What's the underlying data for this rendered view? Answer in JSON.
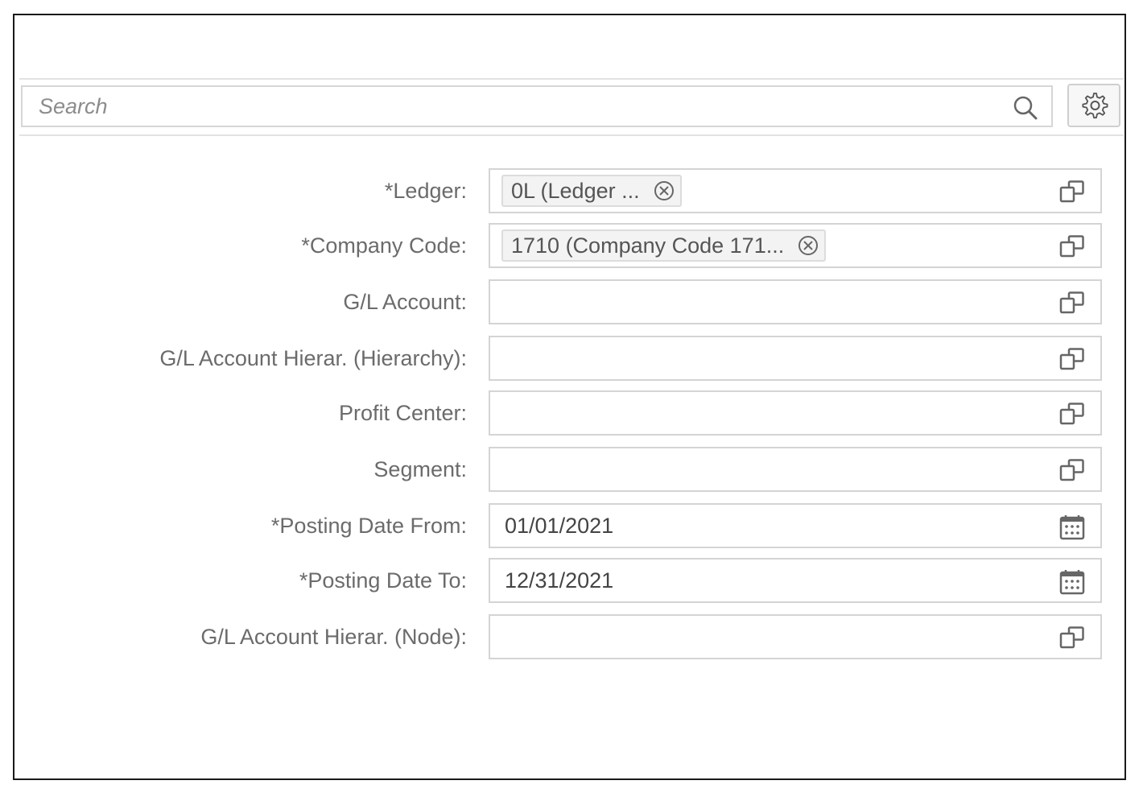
{
  "search": {
    "placeholder": "Search",
    "value": "",
    "search_icon": "search-icon",
    "settings_icon": "gear-icon"
  },
  "form": {
    "fields": [
      {
        "label": "*Ledger:",
        "required": true,
        "type": "multi-input",
        "tokens": [
          "0L (Ledger ..."
        ],
        "value": "",
        "icon": "value-help-icon"
      },
      {
        "label": "*Company Code:",
        "required": true,
        "type": "multi-input",
        "tokens": [
          "1710 (Company Code 171..."
        ],
        "value": "",
        "icon": "value-help-icon"
      },
      {
        "label": "G/L Account:",
        "required": false,
        "type": "multi-input",
        "tokens": [],
        "value": "",
        "icon": "value-help-icon"
      },
      {
        "label": "G/L Account Hierar. (Hierarchy):",
        "required": false,
        "type": "input",
        "tokens": [],
        "value": "",
        "icon": "value-help-icon"
      },
      {
        "label": "Profit Center:",
        "required": false,
        "type": "multi-input",
        "tokens": [],
        "value": "",
        "icon": "value-help-icon"
      },
      {
        "label": "Segment:",
        "required": false,
        "type": "multi-input",
        "tokens": [],
        "value": "",
        "icon": "value-help-icon"
      },
      {
        "label": "*Posting Date From:",
        "required": true,
        "type": "date",
        "tokens": [],
        "value": "01/01/2021",
        "icon": "calendar-icon"
      },
      {
        "label": "*Posting Date To:",
        "required": true,
        "type": "date",
        "tokens": [],
        "value": "12/31/2021",
        "icon": "calendar-icon"
      },
      {
        "label": "G/L Account Hierar. (Node):",
        "required": false,
        "type": "input",
        "tokens": [],
        "value": "",
        "icon": "value-help-icon"
      }
    ]
  },
  "colors": {
    "border": "#d4d4d4",
    "label": "#6b6b6b",
    "token_bg": "#f3f3f3",
    "frame": "#1a1a1a"
  }
}
